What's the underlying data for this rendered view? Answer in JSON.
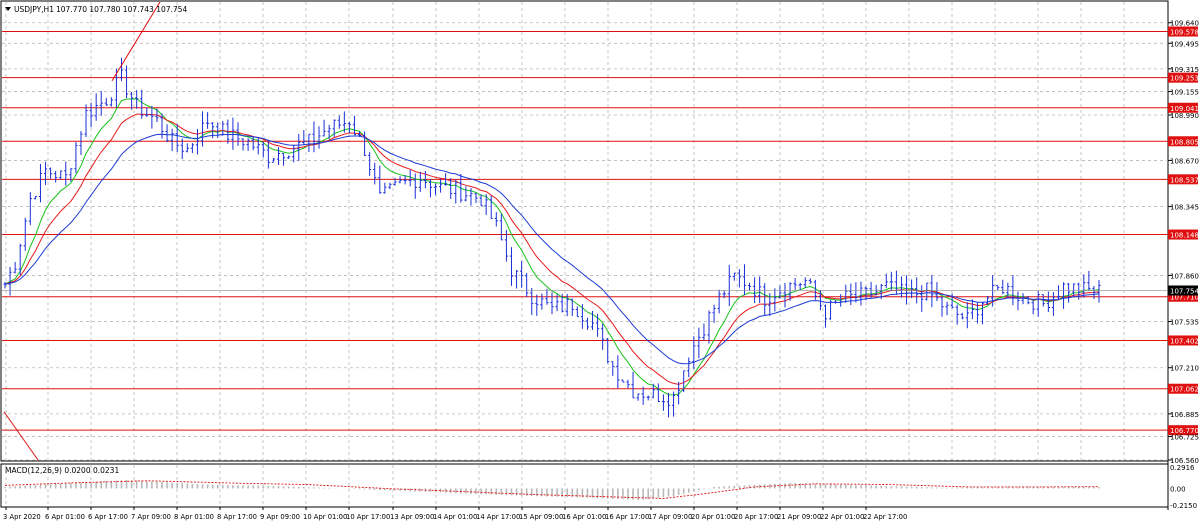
{
  "header": {
    "symbol": "USDJPY,H1",
    "ohlc": "107.770 107.780 107.743 107.754"
  },
  "macd_panel": {
    "label": "MACD(12,26,9) 0.0200 0.0231"
  },
  "colors": {
    "price_bars": "#1a2fd8",
    "level_line": "#e01010",
    "ema_fast": "#17c217",
    "ema_mid": "#e81a1a",
    "ema_slow": "#1b3bd6",
    "grid": "#b9b9b9",
    "macd_hist": "#b8b8b8",
    "macd_signal": "#e01010",
    "current_price_box": "#000000",
    "level_box": "#e01010"
  },
  "chart_data": [
    {
      "type": "candlestick",
      "title": "USDJPY,H1",
      "x_tick_labels": [
        "3 Apr 2020",
        "6 Apr 01:00",
        "6 Apr 17:00",
        "7 Apr 09:00",
        "8 Apr 01:00",
        "8 Apr 17:00",
        "9 Apr 09:00",
        "10 Apr 01:00",
        "10 Apr 17:00",
        "13 Apr 09:00",
        "14 Apr 01:00",
        "14 Apr 17:00",
        "15 Apr 09:00",
        "16 Apr 01:00",
        "16 Apr 17:00",
        "17 Apr 09:00",
        "20 Apr 01:00",
        "20 Apr 17:00",
        "21 Apr 09:00",
        "22 Apr 01:00",
        "22 Apr 17:00"
      ],
      "y_tick_labels": [
        "109.640",
        "109.495",
        "109.315",
        "109.155",
        "108.990",
        "108.670",
        "108.345",
        "107.860",
        "107.535",
        "107.210",
        "106.885",
        "106.725",
        "106.560"
      ],
      "ylim": [
        106.56,
        109.8
      ],
      "current_price": "107.754",
      "horizontal_levels": [
        "109.578",
        "109.253",
        "109.041",
        "108.805",
        "108.537",
        "108.148",
        "107.710",
        "107.402",
        "107.062",
        "106.770"
      ],
      "anchors": [
        [
          0,
          107.8
        ],
        [
          2,
          107.95
        ],
        [
          5,
          108.4
        ],
        [
          8,
          108.6
        ],
        [
          12,
          108.55
        ],
        [
          16,
          109.0
        ],
        [
          20,
          109.1
        ],
        [
          23,
          109.25
        ],
        [
          26,
          109.05
        ],
        [
          30,
          108.95
        ],
        [
          33,
          108.8
        ],
        [
          36,
          108.75
        ],
        [
          40,
          108.95
        ],
        [
          44,
          108.85
        ],
        [
          48,
          108.8
        ],
        [
          52,
          108.7
        ],
        [
          56,
          108.75
        ],
        [
          60,
          108.8
        ],
        [
          64,
          108.9
        ],
        [
          68,
          108.95
        ],
        [
          71,
          108.75
        ],
        [
          74,
          108.4
        ],
        [
          78,
          108.5
        ],
        [
          82,
          108.55
        ],
        [
          86,
          108.48
        ],
        [
          90,
          108.45
        ],
        [
          94,
          108.4
        ],
        [
          97,
          108.2
        ],
        [
          100,
          107.9
        ],
        [
          104,
          107.72
        ],
        [
          108,
          107.62
        ],
        [
          112,
          107.66
        ],
        [
          116,
          107.52
        ],
        [
          120,
          107.22
        ],
        [
          124,
          107.05
        ],
        [
          128,
          107.02
        ],
        [
          132,
          107.0
        ],
        [
          135,
          107.3
        ],
        [
          138,
          107.5
        ],
        [
          141,
          107.7
        ],
        [
          144,
          107.85
        ],
        [
          147,
          107.8
        ],
        [
          150,
          107.7
        ],
        [
          154,
          107.78
        ],
        [
          158,
          107.82
        ],
        [
          162,
          107.6
        ],
        [
          166,
          107.7
        ],
        [
          170,
          107.72
        ],
        [
          174,
          107.78
        ],
        [
          178,
          107.72
        ],
        [
          182,
          107.75
        ],
        [
          186,
          107.62
        ],
        [
          190,
          107.55
        ],
        [
          193,
          107.68
        ],
        [
          197,
          107.78
        ],
        [
          201,
          107.7
        ],
        [
          205,
          107.66
        ],
        [
          209,
          107.78
        ],
        [
          213,
          107.76
        ],
        [
          216,
          107.75
        ]
      ],
      "xlabel": "",
      "ylabel": ""
    },
    {
      "type": "line",
      "title": "MACD(12,26,9) 0.0200 0.0231",
      "y_tick_labels": [
        "0.2916",
        "0.00",
        "-0.2150"
      ],
      "ylim": [
        -0.215,
        0.2916
      ],
      "histogram_anchors": [
        [
          0,
          0.02
        ],
        [
          10,
          0.06
        ],
        [
          24,
          0.11
        ],
        [
          40,
          0.05
        ],
        [
          55,
          0.03
        ],
        [
          70,
          -0.01
        ],
        [
          85,
          -0.05
        ],
        [
          100,
          -0.09
        ],
        [
          115,
          -0.12
        ],
        [
          125,
          -0.15
        ],
        [
          132,
          -0.1
        ],
        [
          140,
          0.02
        ],
        [
          155,
          0.07
        ],
        [
          170,
          0.04
        ],
        [
          185,
          0.01
        ],
        [
          195,
          0.02
        ],
        [
          210,
          0.02
        ],
        [
          216,
          0.02
        ]
      ],
      "signal_anchors": [
        [
          0,
          0.04
        ],
        [
          12,
          0.07
        ],
        [
          28,
          0.1
        ],
        [
          45,
          0.07
        ],
        [
          60,
          0.05
        ],
        [
          75,
          0.0
        ],
        [
          90,
          -0.04
        ],
        [
          105,
          -0.08
        ],
        [
          120,
          -0.11
        ],
        [
          130,
          -0.13
        ],
        [
          138,
          -0.07
        ],
        [
          148,
          0.02
        ],
        [
          160,
          0.06
        ],
        [
          175,
          0.05
        ],
        [
          190,
          0.02
        ],
        [
          205,
          0.02
        ],
        [
          216,
          0.023
        ]
      ],
      "xlabel": "",
      "ylabel": ""
    }
  ]
}
